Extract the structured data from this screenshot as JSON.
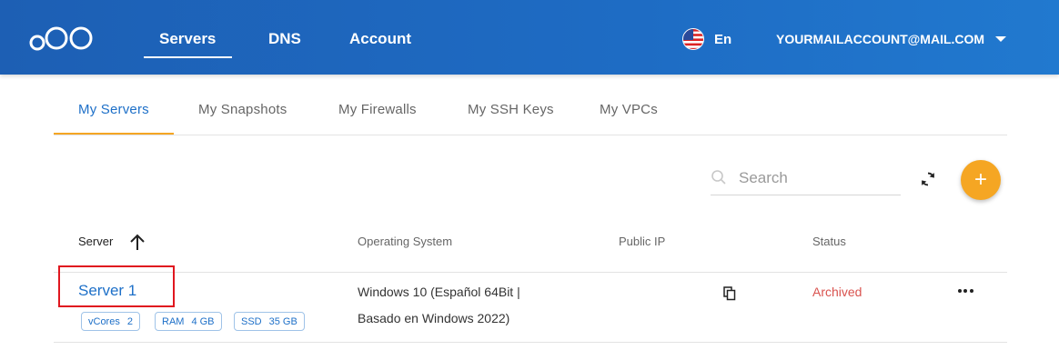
{
  "header": {
    "nav": [
      "Servers",
      "DNS",
      "Account"
    ],
    "language": "En",
    "account_email": "YOURMAILACCOUNT@MAIL.COM"
  },
  "tabs": [
    "My Servers",
    "My Snapshots",
    "My Firewalls",
    "My SSH Keys",
    "My VPCs"
  ],
  "toolbar": {
    "search_placeholder": "Search",
    "add_label": "+"
  },
  "table": {
    "columns": [
      "Server",
      "Operating System",
      "Public IP",
      "Status"
    ],
    "rows": [
      {
        "name": "Server 1",
        "badges": [
          {
            "key": "vCores",
            "value": "2"
          },
          {
            "key": "RAM",
            "value": "4 GB"
          },
          {
            "key": "SSD",
            "value": "35 GB"
          }
        ],
        "os_line1": "Windows 10 (Español 64Bit |",
        "os_line2": "Basado en Windows 2022)",
        "public_ip": "",
        "status": "Archived"
      }
    ]
  },
  "colors": {
    "header_blue": "#1e6cc4",
    "accent_orange": "#f5a623",
    "link_blue": "#1e70c8",
    "status_red": "#d9534f",
    "highlight_red": "#e0171f"
  }
}
